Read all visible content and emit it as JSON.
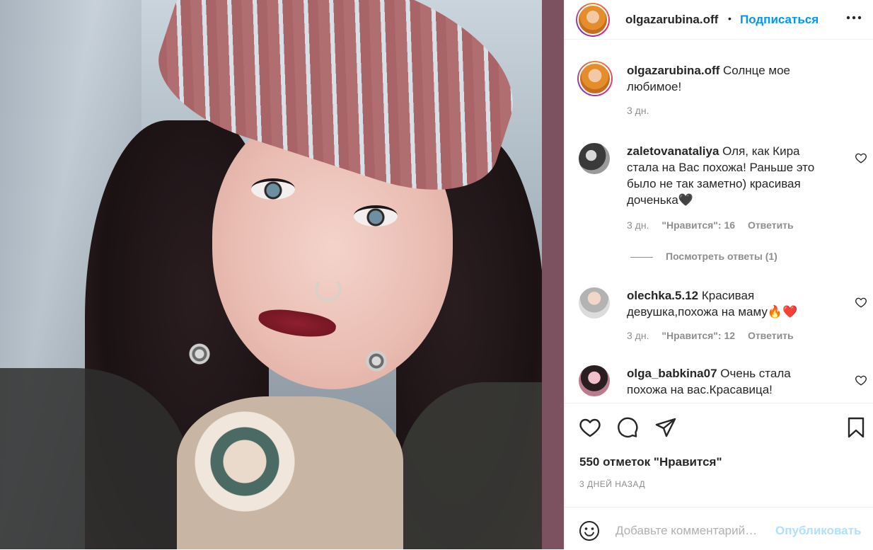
{
  "header": {
    "username": "olgazarubina.off",
    "separator": "•",
    "follow_label": "Подписаться",
    "more_label": "•••"
  },
  "caption": {
    "username": "olgazarubina.off",
    "text": "Солнце мое любимое!",
    "time": "3 дн."
  },
  "comments": [
    {
      "username": "zaletovanataliya",
      "text": "Оля, как Кира стала на Вас похожа! Раньше это было не так заметно) красивая доченька🖤",
      "time": "3 дн.",
      "likes_label": "\"Нравится\": 16",
      "reply_label": "Ответить"
    },
    {
      "username": "olechka.5.12",
      "text": "Красивая девушка,похожа на маму🔥❤️",
      "time": "3 дн.",
      "likes_label": "\"Нравится\": 12",
      "reply_label": "Ответить"
    },
    {
      "username": "olga_babkina07",
      "text": "Очень стала похожа на вас.Красавица!"
    }
  ],
  "view_replies_label": "Посмотреть ответы (1)",
  "likes_count_label": "550 отметок \"Нравится\"",
  "posted_label": "3 ДНЕЙ НАЗАД",
  "compose": {
    "placeholder": "Добавьте комментарий…",
    "publish_label": "Опубликовать"
  },
  "colors": {
    "accent": "#0095f6",
    "publish_disabled": "#b2dffc",
    "muted_text": "#8e8e8e",
    "photo_backdrop": "#7d5260"
  },
  "icons": [
    "more-icon",
    "heart-icon",
    "comment-icon",
    "share-icon",
    "bookmark-icon",
    "emoji-icon"
  ]
}
